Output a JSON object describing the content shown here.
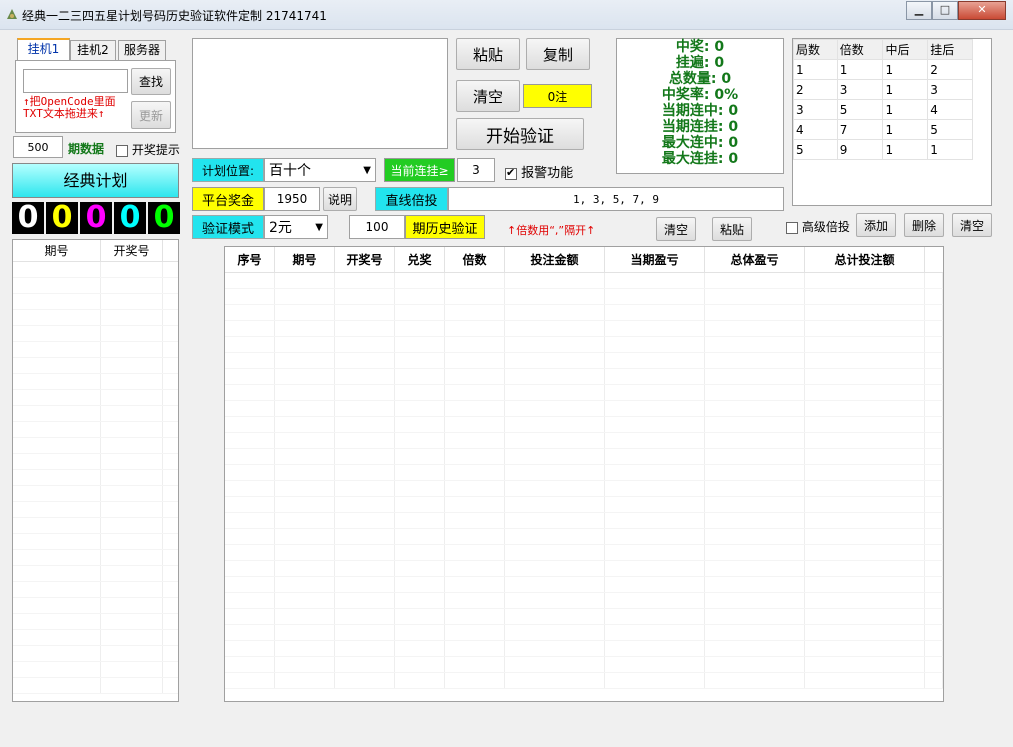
{
  "window": {
    "title": "经典一二三四五星计划号码历史验证软件定制 21741741"
  },
  "tabs": [
    "挂机1",
    "挂机2",
    "服务器"
  ],
  "left": {
    "search_value": "",
    "search_button": "查找",
    "update_button": "更新",
    "hint": "↑把OpenCode里面TXT文本拖进来↑",
    "periods_value": "500",
    "periods_label": "期数据",
    "lottery_tip": "开奖提示",
    "plan_title": "经典计划",
    "digits": [
      "0",
      "0",
      "0",
      "0",
      "0"
    ],
    "list_headers": [
      "期号",
      "开奖号"
    ]
  },
  "controls": {
    "paste": "粘贴",
    "copy": "复制",
    "clear": "清空",
    "bets": "0注",
    "start": "开始验证",
    "plan_pos_label": "计划位置:",
    "plan_pos_value": "百十个",
    "current_streak_label": "当前连挂≥",
    "current_streak_value": "3",
    "alarm": "报警功能",
    "platform_prize_label": "平台奖金",
    "platform_prize_value": "1950",
    "explain": "说明",
    "linear_label": "直线倍投",
    "linear_value": "1, 3, 5, 7, 9",
    "verify_mode_label": "验证模式",
    "verify_mode_value": "2元",
    "history_value": "100",
    "history_button": "期历史验证",
    "multiplier_hint": "↑倍数用“,”隔开↑",
    "clear2": "清空",
    "paste2": "粘贴"
  },
  "stats": [
    "中奖: 0",
    "挂遍: 0",
    "总数量: 0",
    "中奖率: 0%",
    "当期连中: 0",
    "当期连挂: 0",
    "最大连中: 0",
    "最大连挂: 0"
  ],
  "bet_table": {
    "headers": [
      "局数",
      "倍数",
      "中后",
      "挂后"
    ],
    "rows": [
      [
        "1",
        "1",
        "1",
        "2"
      ],
      [
        "2",
        "3",
        "1",
        "3"
      ],
      [
        "3",
        "5",
        "1",
        "4"
      ],
      [
        "4",
        "7",
        "1",
        "5"
      ],
      [
        "5",
        "9",
        "1",
        "1"
      ]
    ]
  },
  "advanced": {
    "label": "高级倍投",
    "add": "添加",
    "delete": "删除",
    "clear": "清空"
  },
  "results_table": {
    "headers": [
      "序号",
      "期号",
      "开奖号",
      "兑奖",
      "倍数",
      "投注金额",
      "当期盈亏",
      "总体盈亏",
      "总计投注额"
    ]
  },
  "colors": {
    "stats_green": "#13781a",
    "cyan": "#22e4ee",
    "yellow": "#ffff00",
    "green": "#22cc22",
    "digit_colors": [
      "#ffffff",
      "#ffff00",
      "#ff00ff",
      "#00ffff",
      "#00ff00"
    ]
  }
}
